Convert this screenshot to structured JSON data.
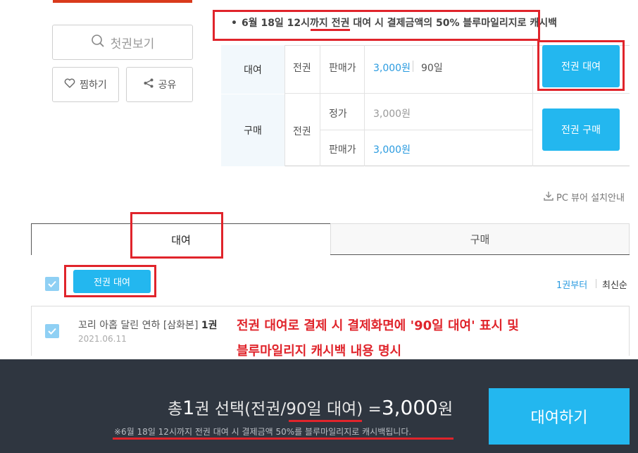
{
  "colors": {
    "accent": "#23b7ef",
    "price_blue": "#2a9be0",
    "highlight_red": "#e0242b",
    "footer_bg": "#2f3640"
  },
  "actions": {
    "preview_label": "첫권보기",
    "wish_label": "찜하기",
    "share_label": "공유"
  },
  "promo": {
    "text_before": "6월 18일 12시까지 ",
    "text_underlined": "전권 대여",
    "text_after": " 시 결제금액의 50% 블루마일리지로 캐시백"
  },
  "price_table": {
    "rent": {
      "label": "대여",
      "scope": "전권",
      "price_label": "판매가",
      "price": "3,000원",
      "period": "90일",
      "button": "전권 대여"
    },
    "buy": {
      "label": "구매",
      "scope": "전권",
      "list_label": "정가",
      "list_price": "3,000원",
      "price_label": "판매가",
      "price": "3,000원",
      "button": "전권 구매"
    }
  },
  "pc_viewer_label": "PC 뷰어 설치안내",
  "tabs": [
    {
      "label": "대여",
      "active": true
    },
    {
      "label": "구매",
      "active": false
    }
  ],
  "list_toolbar": {
    "rent_all_button": "전권 대여",
    "sort_options": [
      "1권부터",
      "최신순"
    ]
  },
  "items": [
    {
      "title": "꼬리 아홉 달린 연하 [삼화본]",
      "volume": "1권",
      "date": "2021.06.11"
    }
  ],
  "annotation": {
    "line1": "전권 대여로 결제 시 결제화면에 '90일 대여' 표시 및",
    "line2": "블루마일리지 캐시백 내용 명시"
  },
  "footer": {
    "total_prefix": "총 ",
    "count": "1",
    "select_prefix": "권 선택(전권/",
    "period_text": "90일 대여",
    "select_suffix": ") = ",
    "price": "3,000",
    "currency": "원",
    "note": "※6월 18일 12시까지 전권 대여 시 결제금액 50%를 블루마일리지로 캐시백됩니다.",
    "cta": "대여하기"
  }
}
